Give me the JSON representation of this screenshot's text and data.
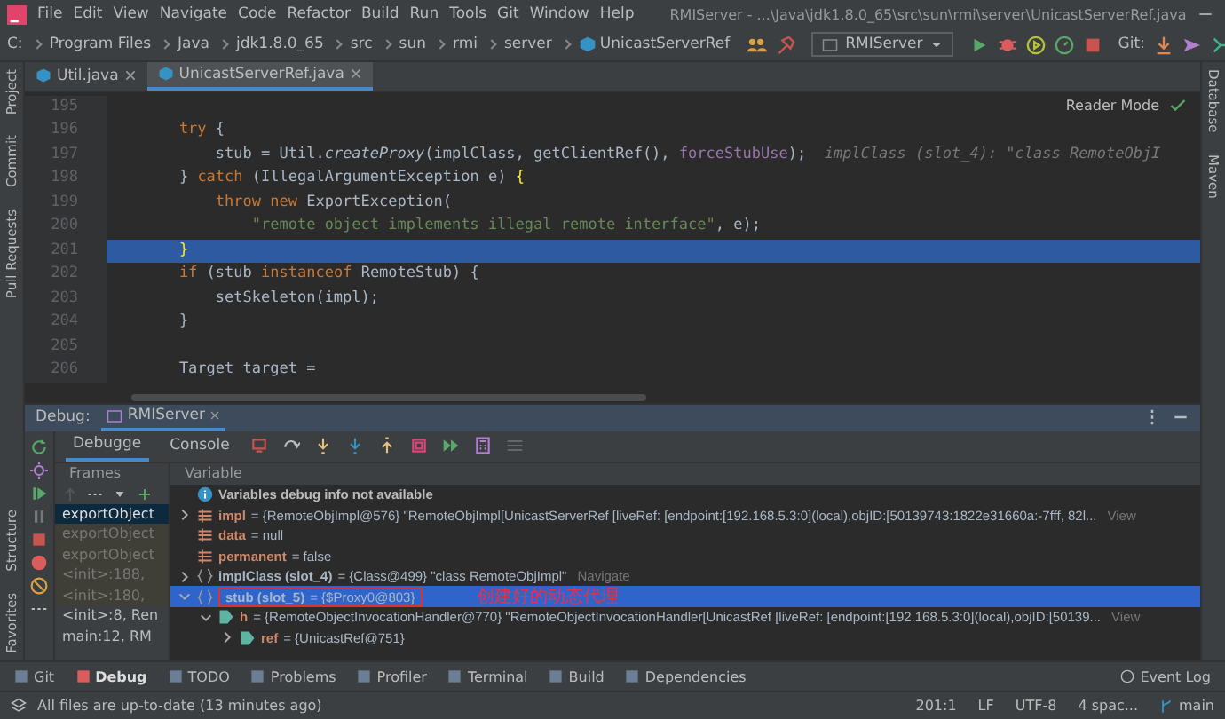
{
  "menu": [
    "File",
    "Edit",
    "View",
    "Navigate",
    "Code",
    "Refactor",
    "Build",
    "Run",
    "Tools",
    "Git",
    "Window",
    "Help"
  ],
  "window": {
    "title": "RMIServer - ...\\Java\\jdk1.8.0_65\\src\\sun\\rmi\\server\\UnicastServerRef.java"
  },
  "breadcrumbs": [
    "C:",
    "Program Files",
    "Java",
    "jdk1.8.0_65",
    "src",
    "sun",
    "rmi",
    "server",
    "UnicastServerRef"
  ],
  "run_config": "RMIServer",
  "git_label": "Git:",
  "left_strip_top": [
    "Project",
    "Commit",
    "Pull Requests"
  ],
  "left_strip_bottom": [
    "Structure",
    "Favorites"
  ],
  "right_strip": [
    "Database",
    "Maven"
  ],
  "tabs": [
    {
      "label": "Util.java",
      "selected": false
    },
    {
      "label": "UnicastServerRef.java",
      "selected": true
    }
  ],
  "reader_mode": "Reader Mode",
  "code_lines": [
    {
      "number": "195"
    },
    {
      "number": "196",
      "selected": false,
      "tokens": [
        {
          "kind": "keyword",
          "text": "        try"
        },
        {
          "kind": "plain",
          "text": " {"
        }
      ]
    },
    {
      "number": "197",
      "selected": false,
      "tokens": [
        {
          "kind": "plain",
          "text": "            stub = Util."
        },
        {
          "kind": "method",
          "text": "createProxy"
        },
        {
          "kind": "plain",
          "text": "(implClass, getClientRef(), "
        },
        {
          "kind": "field",
          "text": "forceStubUse"
        },
        {
          "kind": "plain",
          "text": ");"
        },
        {
          "kind": "hint",
          "text": "  implClass (slot_4): \"class RemoteObjI"
        }
      ]
    },
    {
      "number": "198",
      "selected": false,
      "tokens": [
        {
          "kind": "plain",
          "text": "        } "
        },
        {
          "kind": "keyword",
          "text": "catch"
        },
        {
          "kind": "plain",
          "text": " (IllegalArgumentException e) "
        },
        {
          "kind": "brace",
          "text": "{"
        }
      ]
    },
    {
      "number": "199",
      "selected": false,
      "tokens": [
        {
          "kind": "keyword",
          "text": "            throw new"
        },
        {
          "kind": "plain",
          "text": " ExportException("
        }
      ]
    },
    {
      "number": "200",
      "selected": false,
      "tokens": [
        {
          "kind": "string",
          "text": "                \"remote object implements illegal remote interface\""
        },
        {
          "kind": "plain",
          "text": ", e);"
        }
      ]
    },
    {
      "number": "201",
      "selected": true,
      "tokens": [
        {
          "kind": "brace",
          "text": "        }"
        }
      ]
    },
    {
      "number": "202",
      "selected": false,
      "tokens": [
        {
          "kind": "keyword",
          "text": "        if"
        },
        {
          "kind": "plain",
          "text": " (stub "
        },
        {
          "kind": "keyword",
          "text": "instanceof"
        },
        {
          "kind": "plain",
          "text": " RemoteStub) {"
        }
      ]
    },
    {
      "number": "203",
      "selected": false,
      "tokens": [
        {
          "kind": "plain",
          "text": "            setSkeleton(impl);"
        }
      ]
    },
    {
      "number": "204",
      "selected": false,
      "tokens": [
        {
          "kind": "plain",
          "text": "        }"
        }
      ]
    },
    {
      "number": "205"
    },
    {
      "number": "206",
      "selected": false,
      "tokens": [
        {
          "kind": "plain",
          "text": "        Target target ="
        }
      ]
    }
  ],
  "debug": {
    "label": "Debug:",
    "session": "RMIServer",
    "tabs": [
      {
        "label": "Debugge",
        "selected": true
      },
      {
        "label": "Console",
        "selected": false
      }
    ],
    "frames_header": "Frames",
    "variables_header": "Variable",
    "frames": [
      {
        "text": "exportObject",
        "selected": true,
        "library": false
      },
      {
        "text": "exportObject",
        "selected": false,
        "library": true
      },
      {
        "text": "exportObject",
        "selected": false,
        "library": true
      },
      {
        "text": "<init>:188,",
        "selected": false,
        "library": true
      },
      {
        "text": "<init>:180,",
        "selected": false,
        "library": true
      },
      {
        "text": "<init>:8, Ren",
        "selected": false,
        "library": false
      },
      {
        "text": "main:12, RM",
        "selected": false,
        "library": false
      }
    ],
    "variables": [
      {
        "kind": "info",
        "name": "Variables debug info not available",
        "selected": false
      },
      {
        "kind": "field",
        "name": "impl",
        "value": "= {RemoteObjImpl@576} \"RemoteObjImpl[UnicastServerRef [liveRef: [endpoint:[192.168.5.3:0](local),objID:[50139743:1822e31660a:-7fff, 82l...",
        "link": "View",
        "expanded": false,
        "selected": false
      },
      {
        "kind": "field",
        "name": "data",
        "value": "= null",
        "selected": false
      },
      {
        "kind": "field",
        "name": "permanent",
        "value": "= false",
        "selected": false
      },
      {
        "kind": "local",
        "name": "implClass (slot_4)",
        "value": "= {Class@499} \"class RemoteObjImpl\"",
        "link": "Navigate",
        "expanded": false,
        "selected": false
      },
      {
        "kind": "local",
        "name": "stub (slot_5)",
        "value": "= {$Proxy0@803}",
        "expanded": true,
        "selected": true,
        "boxed": true,
        "annotation": "创建好的动态代理",
        "children": [
          {
            "kind": "member",
            "name": "h",
            "value": "= {RemoteObjectInvocationHandler@770} \"RemoteObjectInvocationHandler[UnicastRef [liveRef: [endpoint:[192.168.5.3:0](local),objID:[50139...",
            "link": "View",
            "expanded": true,
            "selected": false,
            "children": [
              {
                "kind": "member",
                "name": "ref",
                "value": "= {UnicastRef@751}",
                "expanded": false,
                "selected": false
              }
            ]
          }
        ]
      }
    ]
  },
  "tool_windows": [
    {
      "label": "Git",
      "selected": false
    },
    {
      "label": "Debug",
      "selected": true
    },
    {
      "label": "TODO",
      "selected": false
    },
    {
      "label": "Problems",
      "selected": false
    },
    {
      "label": "Profiler",
      "selected": false
    },
    {
      "label": "Terminal",
      "selected": false
    },
    {
      "label": "Build",
      "selected": false
    },
    {
      "label": "Dependencies",
      "selected": false
    }
  ],
  "event_log": "Event Log",
  "status": {
    "message": "All files are up-to-date (13 minutes ago)",
    "position": "201:1",
    "line_sep": "LF",
    "encoding": "UTF-8",
    "indent": "4 spac...",
    "branch": "main"
  }
}
